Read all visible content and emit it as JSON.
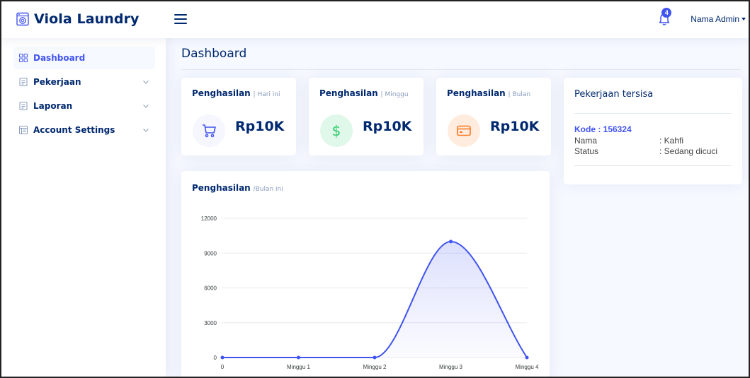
{
  "header": {
    "app_name": "Viola Laundry",
    "notification_count": "4",
    "admin_name": "Nama Admin"
  },
  "sidebar": {
    "items": [
      {
        "label": "Dashboard",
        "icon": "grid-icon",
        "active": true
      },
      {
        "label": "Pekerjaan",
        "icon": "document-icon",
        "expandable": true
      },
      {
        "label": "Laporan",
        "icon": "document-icon",
        "expandable": true
      },
      {
        "label": "Account Settings",
        "icon": "list-icon",
        "expandable": true
      }
    ]
  },
  "main": {
    "page_title": "Dashboard",
    "cards": [
      {
        "title": "Penghasilan",
        "period": "| Hari ini",
        "amount": "Rp10K",
        "icon": "cart-icon",
        "icon_bg": "#f6f6fe",
        "icon_color": "#4154f1"
      },
      {
        "title": "Penghasilan",
        "period": "| Minggu",
        "amount": "Rp10K",
        "icon": "dollar-icon",
        "icon_bg": "#e0f8e9",
        "icon_color": "#2eca6a"
      },
      {
        "title": "Penghasilan",
        "period": "| Bulan",
        "amount": "Rp10K",
        "icon": "credit-card-icon",
        "icon_bg": "#ffecdf",
        "icon_color": "#ff771d"
      }
    ],
    "remaining_jobs": {
      "title": "Pekerjaan tersisa",
      "code": "Kode : 156324",
      "rows": [
        {
          "key": "Nama",
          "value": ": Kahfi"
        },
        {
          "key": "Status",
          "value": ": Sedang dicuci"
        }
      ]
    },
    "chart_card": {
      "title": "Penghasilan",
      "period": "/Bulan ini"
    }
  },
  "colors": {
    "accent": "#4154f1",
    "navy": "#012970",
    "muted": "#899bbd"
  },
  "chart_data": {
    "type": "area",
    "title": "",
    "x": [
      "0",
      "Minggu 1",
      "Minggu 2",
      "Minggu 3",
      "Minggu 4"
    ],
    "series": [
      {
        "values": [
          0,
          0,
          0,
          10000,
          0
        ]
      }
    ],
    "yticks": [
      0,
      3000,
      6000,
      9000,
      12000
    ],
    "ylim": [
      0,
      12000
    ],
    "grid": true,
    "color": "#4154f1"
  }
}
